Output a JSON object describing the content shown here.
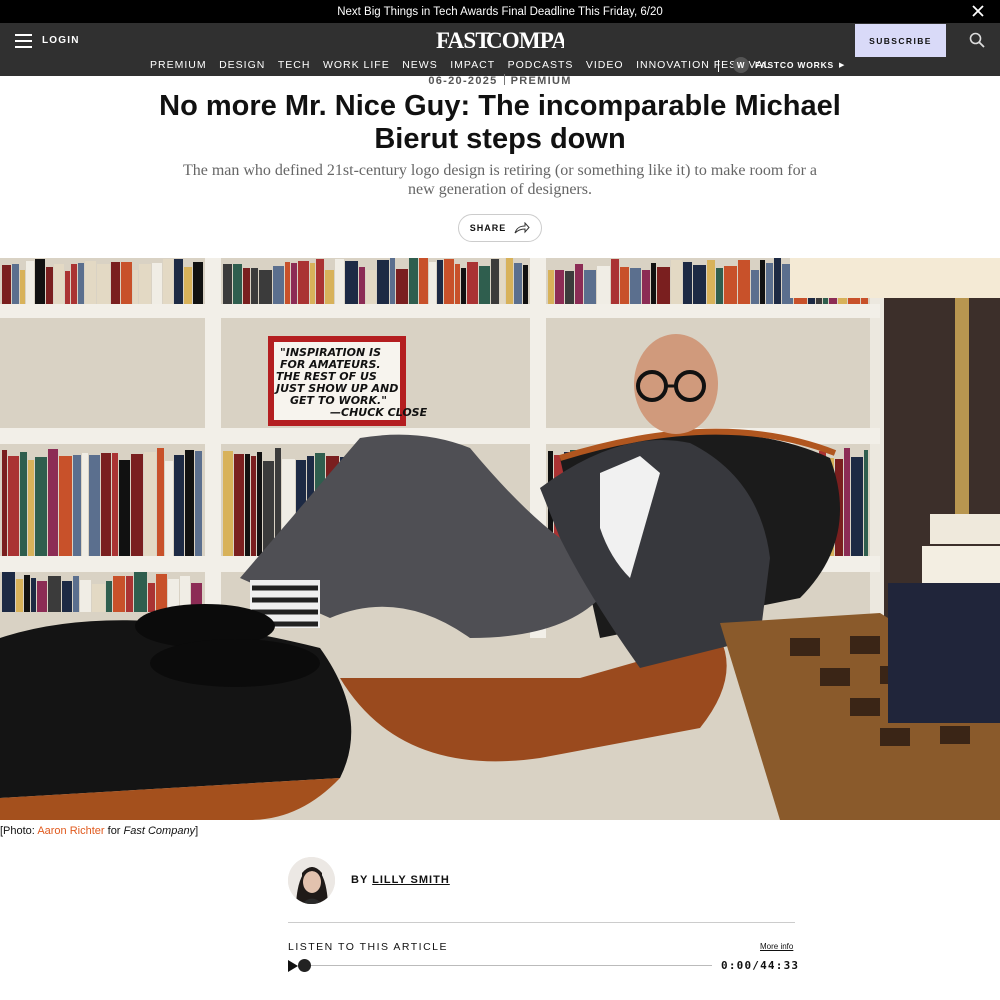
{
  "promo": {
    "text": "Next Big Things in Tech Awards Final Deadline This Friday, 6/20"
  },
  "header": {
    "login": "LOGIN",
    "logo": "FAST COMPANY",
    "subscribe": "SUBSCRIBE",
    "nav": [
      "PREMIUM",
      "DESIGN",
      "TECH",
      "WORK LIFE",
      "NEWS",
      "IMPACT",
      "PODCASTS",
      "VIDEO",
      "INNOVATION FESTIVAL"
    ],
    "fastco_badge": "W",
    "fastco_works": "FASTCO WORKS"
  },
  "article": {
    "date": "06-20-2025",
    "section": "PREMIUM",
    "headline": "No more Mr. Nice Guy: The incomparable Michael Bierut steps down",
    "dek": "The man who defined 21st-century logo design is retiring (or something like it) to make room for a new generation of designers.",
    "share": "SHARE",
    "caption": {
      "prefix": "[Photo: ",
      "photographer": "Aaron Richter",
      "middle": " for ",
      "publication": "Fast Company",
      "suffix": "]"
    },
    "byline_prefix": "BY",
    "author": "LILLY SMITH"
  },
  "audio": {
    "label": "LISTEN TO THIS ARTICLE",
    "more_info": "More info",
    "time": "0:00/44:33",
    "progress": 0
  },
  "hero_sign_text": [
    "\"INSPIRATION IS",
    "FOR AMATEURS.",
    "THE REST OF US",
    "JUST SHOW UP AND",
    "GET TO WORK.\"",
    "—CHUCK CLOSE"
  ],
  "colors": {
    "promo_bg": "#000000",
    "header_bg": "#303030",
    "subscribe_bg": "#d9daf8",
    "caption_link": "#e05a1e"
  }
}
